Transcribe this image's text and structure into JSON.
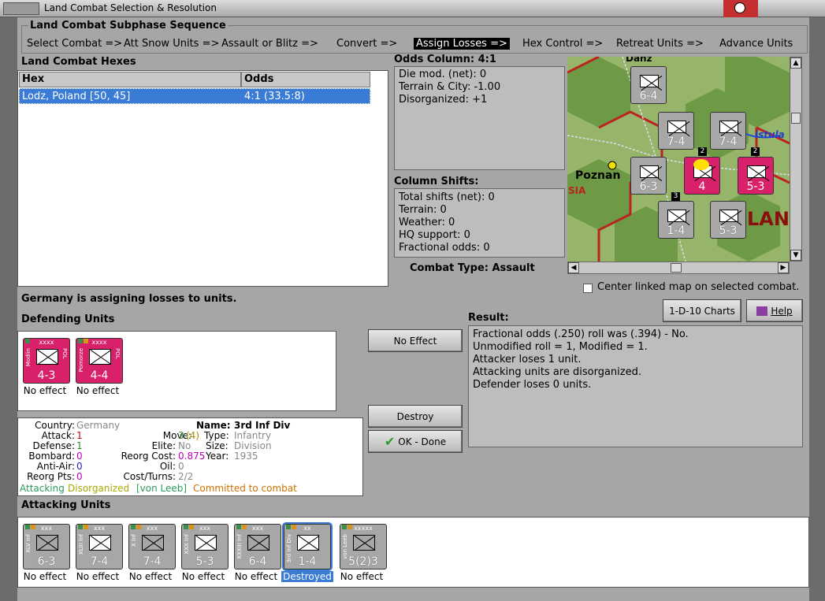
{
  "window": {
    "title": "Land Combat Selection & Resolution"
  },
  "subphase": {
    "header": "Land Combat Subphase Sequence",
    "steps": [
      "Select Combat =>",
      "Att Snow Units =>",
      "Assault or Blitz =>",
      "Convert =>",
      "Assign Losses =>",
      "Hex Control =>",
      "Retreat Units =>",
      "Advance Units"
    ],
    "active_index": 4
  },
  "hexes": {
    "header": "Land Combat Hexes",
    "col_hex": "Hex",
    "col_odds": "Odds",
    "rows": [
      {
        "hex": "Lodz, Poland [50, 45]",
        "odds": "4:1 (33.5:8)"
      }
    ]
  },
  "odds": {
    "header": "Odds Column: 4:1",
    "lines": [
      "Die mod. (net): 0",
      "Terrain & City: -1.00",
      "Disorganized: +1"
    ]
  },
  "shifts": {
    "header": "Column Shifts:",
    "lines": [
      "Total shifts (net): 0",
      "Terrain: 0",
      "Weather: 0",
      "HQ support: 0",
      "Fractional odds: 0"
    ]
  },
  "combat_type": "Combat Type:  Assault",
  "map": {
    "labels": {
      "poznan": "Poznan",
      "vistula": "istula",
      "danz": "Danz",
      "lan": "LAN",
      "sia": "SIA"
    },
    "units": [
      {
        "str": "6-4"
      },
      {
        "str": "7-4"
      },
      {
        "str": "7-4"
      },
      {
        "str": "6-3"
      },
      {
        "str": "4"
      },
      {
        "str": "5-3"
      },
      {
        "str": "1-4"
      },
      {
        "str": "5-3"
      }
    ],
    "badges": [
      "2",
      "2",
      "3"
    ]
  },
  "center_linked": "Center linked map on selected combat.",
  "buttons": {
    "charts": "1-D-10 Charts",
    "help": "Help",
    "no_effect": "No Effect",
    "destroy": "Destroy",
    "ok_done": "OK - Done"
  },
  "status": "Germany is assigning losses to units.",
  "defending": {
    "header": "Defending Units",
    "units": [
      {
        "size": "xxxx",
        "name": "Modlin",
        "country": "POL",
        "str": "4-3",
        "result": "No effect"
      },
      {
        "size": "xxxx",
        "name": "Pomorze",
        "country": "POL",
        "str": "4-4",
        "result": "No effect"
      }
    ]
  },
  "result": {
    "header": "Result:",
    "lines": [
      "Fractional odds (.250) roll was (.394)  - No.",
      "Unmodified roll = 1, Modified = 1.",
      "Attacker loses 1 unit.",
      "Attacking units are disorganized.",
      "Defender loses 0 units."
    ]
  },
  "info": {
    "country_k": "Country:",
    "country_v": "Germany",
    "attack_k": "Attack:",
    "attack_v": "1",
    "defense_k": "Defense:",
    "defense_v": "1",
    "bombard_k": "Bombard:",
    "bombard_v": "0",
    "antiair_k": "Anti-Air:",
    "antiair_v": "0",
    "reorgpts_k": "Reorg Pts:",
    "reorgpts_v": "0",
    "name_k": "Name:",
    "name_v": "3rd Inf Div",
    "move_k": "Move:",
    "move_v1": "3",
    "move_v2": "(4)",
    "elite_k": "Elite:",
    "elite_v": "No",
    "reorgcost_k": "Reorg Cost:",
    "reorgcost_v": "0.875",
    "oil_k": "Oil:",
    "oil_v": "0",
    "costturns_k": "Cost/Turns:",
    "costturns_v": "2/2",
    "type_k": "Type:",
    "type_v": "Infantry",
    "size_k": "Size:",
    "size_v": "Division",
    "year_k": "Year:",
    "year_v": "1935",
    "status_attacking": "Attacking",
    "status_disorg": "Disorganized",
    "status_leader": "[von Leeb]",
    "status_committed": "Committed to combat"
  },
  "attacking": {
    "header": "Attacking Units",
    "units": [
      {
        "size": "xxx",
        "name": "XLV Inf",
        "str": "6-3",
        "result": "No effect"
      },
      {
        "size": "xxx",
        "name": "XLIII Inf",
        "str": "7-4",
        "result": "No effect"
      },
      {
        "size": "xxx",
        "name": "X Inf",
        "str": "7-4",
        "result": "No effect"
      },
      {
        "size": "xxx",
        "name": "XXX Inf",
        "str": "5-3",
        "result": "No effect"
      },
      {
        "size": "xxx",
        "name": "XXXIII Inf",
        "str": "6-4",
        "result": "No effect"
      },
      {
        "size": "xx",
        "name": "3rd Inf Div",
        "str": "1-4",
        "result": "Destroyed"
      },
      {
        "size": "xxxxx",
        "name": "von Leeb",
        "str": "5(2)3",
        "result": "No effect"
      }
    ]
  }
}
